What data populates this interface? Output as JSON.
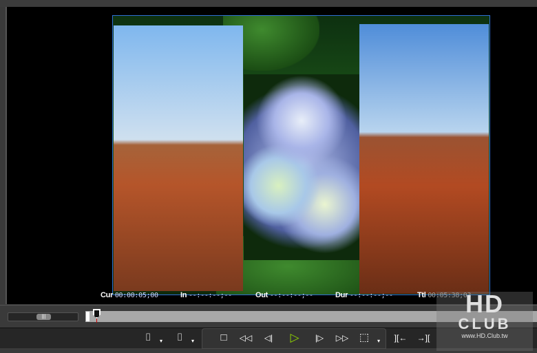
{
  "timecodes": {
    "cur_label": "Cur",
    "cur_value": "00:00:05;00",
    "in_label": "In",
    "in_value": "--:--:--;--",
    "out_label": "Out",
    "out_value": "--:--:--;--",
    "dur_label": "Dur",
    "dur_value": "--:--:--;--",
    "ttl_label": "Ttl",
    "ttl_value": "00:05:38;03"
  },
  "controls": {
    "mark_in": "⌷",
    "mark_out": "⌷",
    "dropdown": "▾",
    "stop": "□",
    "rewind": "◁◁",
    "prev_frame": "◁|",
    "play": "▷",
    "next_frame": "|▷",
    "fast_forward": "▷▷",
    "loop": "⬚",
    "go_in": "][←",
    "go_out": "→]["
  },
  "scrub": {
    "zoom_thumb": "|||",
    "playhead_time": "00:00:05;00"
  },
  "colors": {
    "accent_play": "#8fd400",
    "frame_border": "#2f6fd6"
  },
  "watermark": {
    "logo": "HD",
    "club": "CLUB",
    "url": "www.HD.Club.tw"
  }
}
